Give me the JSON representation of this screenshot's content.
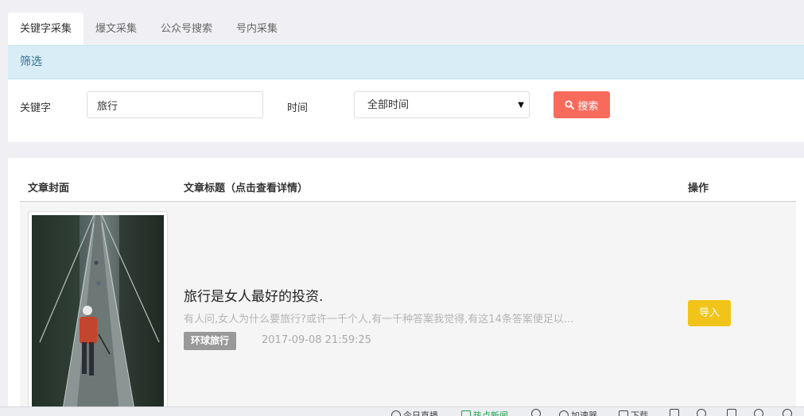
{
  "tabs": [
    {
      "label": "关键字采集",
      "active": true
    },
    {
      "label": "爆文采集",
      "active": false
    },
    {
      "label": "公众号搜索",
      "active": false
    },
    {
      "label": "号内采集",
      "active": false
    }
  ],
  "filter": {
    "header": "筛选",
    "keyword_label": "关键字",
    "keyword_value": "旅行",
    "time_label": "时间",
    "time_selected": "全部时间",
    "search_label": "搜索"
  },
  "table": {
    "headers": [
      "文章封面",
      "文章标题（点击查看详情）",
      "操作"
    ],
    "rows": [
      {
        "title": "旅行是女人最好的投资.",
        "summary": "有人问,女人为什么要旅行?或许一千个人,有一千种答案我觉得,有这14条答案便足以...",
        "tag": "环球旅行",
        "date": "2017-09-08 21:59:25",
        "action": "导入"
      }
    ]
  },
  "taskbar": {
    "items": [
      "今日直播",
      "热点新闻",
      "加速器",
      "下载"
    ]
  },
  "colors": {
    "accent_search": "#f86b5c",
    "import_button": "#f0c419",
    "filter_header_bg": "#d9edf7",
    "filter_header_text": "#31708f",
    "tag_bg": "#999999"
  }
}
